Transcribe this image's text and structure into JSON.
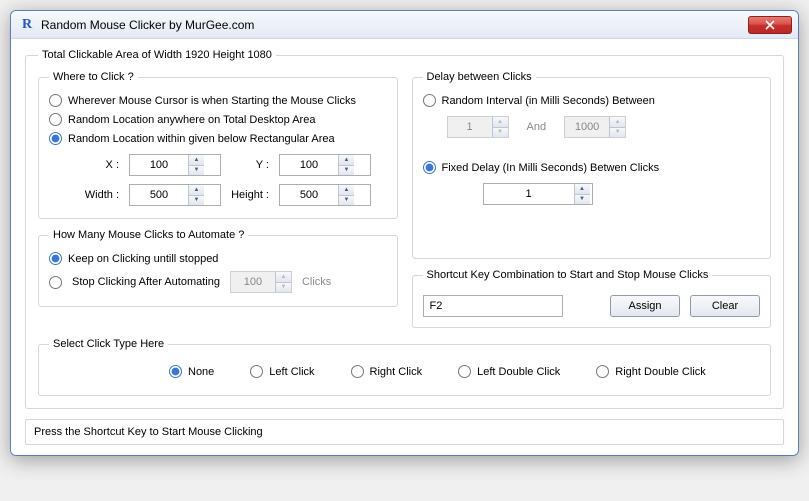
{
  "window": {
    "title": "Random Mouse Clicker by MurGee.com"
  },
  "outer": {
    "legend": "Total Clickable Area of Width 1920 Height 1080"
  },
  "where": {
    "legend": "Where to Click ?",
    "opt1": "Wherever Mouse Cursor is when Starting the Mouse Clicks",
    "opt2": "Random Location anywhere on Total Desktop Area",
    "opt3": "Random Location within given below Rectangular Area",
    "x_label": "X :",
    "x_value": "100",
    "y_label": "Y :",
    "y_value": "100",
    "w_label": "Width :",
    "w_value": "500",
    "h_label": "Height :",
    "h_value": "500"
  },
  "delay": {
    "legend": "Delay between Clicks",
    "random_label": "Random Interval (in Milli Seconds) Between",
    "rand_min": "1",
    "and_label": "And",
    "rand_max": "1000",
    "fixed_label": "Fixed Delay (In Milli Seconds) Betwen Clicks",
    "fixed_value": "1"
  },
  "howmany": {
    "legend": "How Many Mouse Clicks to Automate ?",
    "keep": "Keep on Clicking untill stopped",
    "stop": "Stop Clicking After Automating",
    "count": "100",
    "clicks_text": "Clicks"
  },
  "shortcut": {
    "legend": "Shortcut Key Combination to Start and Stop Mouse Clicks",
    "value": "F2",
    "assign": "Assign",
    "clear": "Clear"
  },
  "clicktype": {
    "legend": "Select Click Type Here",
    "none": "None",
    "left": "Left Click",
    "right": "Right Click",
    "leftdbl": "Left Double Click",
    "rightdbl": "Right Double Click"
  },
  "status": "Press the Shortcut Key to Start Mouse Clicking"
}
